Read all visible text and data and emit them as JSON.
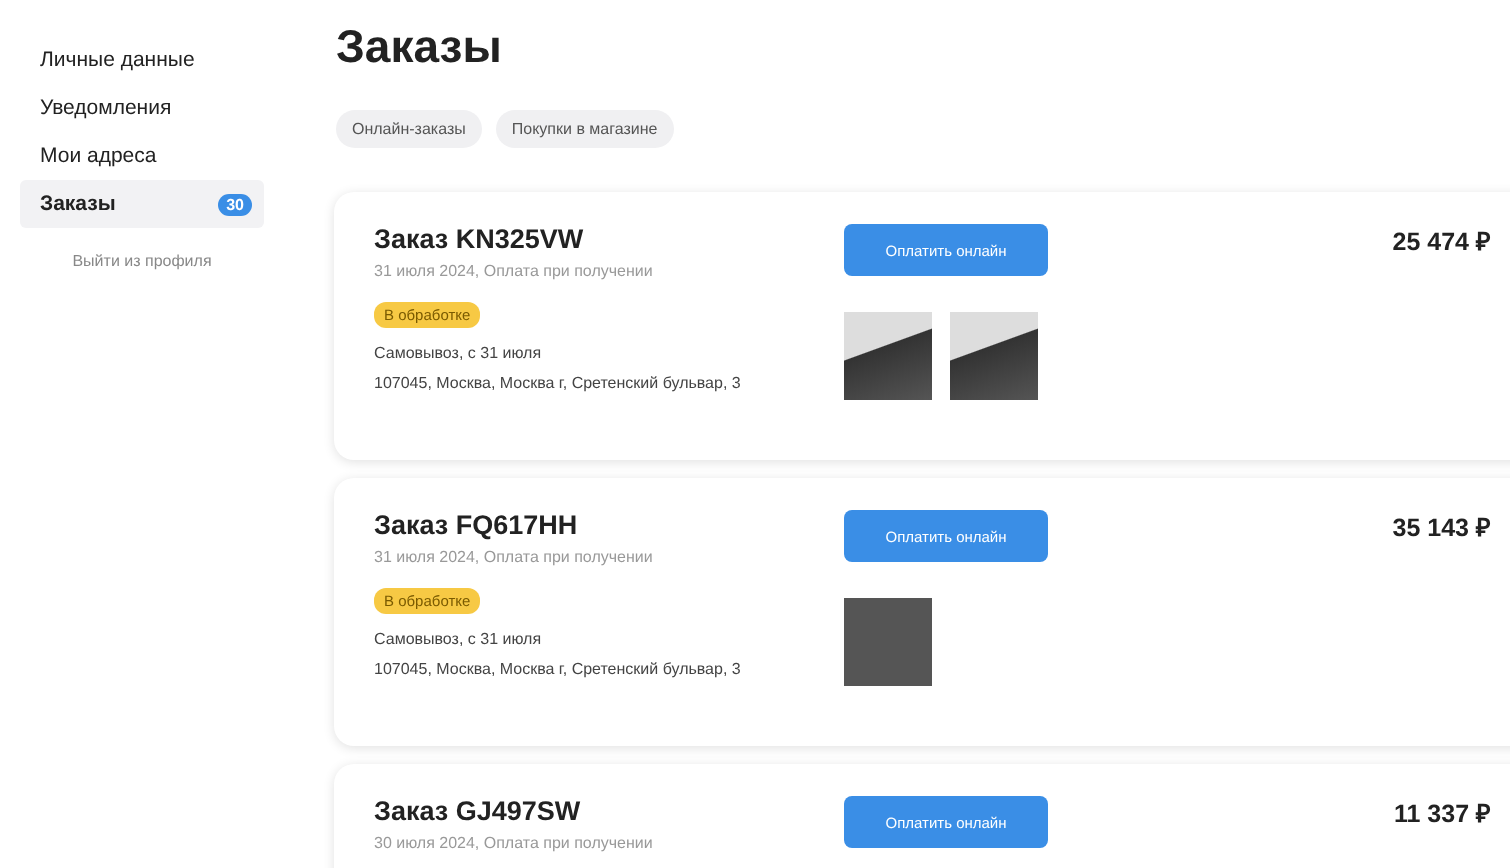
{
  "sidebar": {
    "items": [
      {
        "label": "Личные данные",
        "selected": false
      },
      {
        "label": "Уведомления",
        "selected": false
      },
      {
        "label": "Мои адреса",
        "selected": false
      },
      {
        "label": "Заказы",
        "selected": true,
        "badge": "30"
      }
    ],
    "logout": "Выйти из профиля"
  },
  "page_title": "Заказы",
  "tabs": [
    {
      "label": "Онлайн-заказы",
      "selected": false
    },
    {
      "label": "Покупки в магазине",
      "selected": false
    }
  ],
  "orders": [
    {
      "title": "Заказ KN325VW",
      "date": "31 июля 2024, Оплата при получении",
      "status": "В обработке",
      "delivery": "Самовывоз, с 31 июля",
      "address": "107045, Москва, Москва г, Сретенский бульвар, 3",
      "button": "Оплатить онлайн",
      "price": "25 474 ₽",
      "photos": [
        {
          "kind": "light"
        },
        {
          "kind": "light"
        }
      ]
    },
    {
      "title": "Заказ FQ617HH",
      "date": "31 июля 2024, Оплата при получении",
      "status": "В обработке",
      "delivery": "Самовывоз, с 31 июля",
      "address": "107045, Москва, Москва г, Сретенский бульвар, 3",
      "button": "Оплатить онлайн",
      "price": "35 143 ₽",
      "photos": [
        {
          "kind": "dark"
        }
      ]
    },
    {
      "title": "Заказ GJ497SW",
      "date": "30 июля 2024, Оплата при получении",
      "button": "Оплатить онлайн",
      "price": "11 337 ₽"
    }
  ]
}
